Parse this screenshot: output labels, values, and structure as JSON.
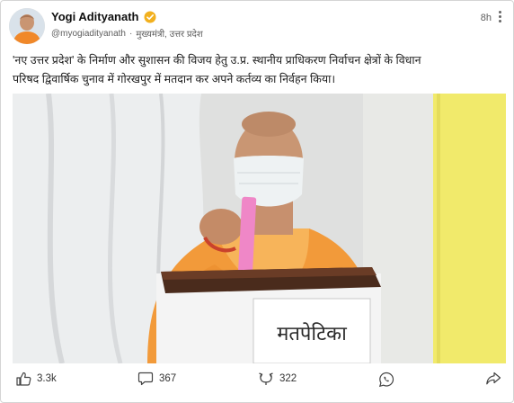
{
  "post": {
    "author_name": "Yogi Adityanath",
    "handle": "@myogiadityanath",
    "separator": "·",
    "designation": "मुख्यमंत्री, उत्तर प्रदेश",
    "time": "8h",
    "text_line1": "'नए उत्तर प्रदेश' के निर्माण और सुशासन की विजय हेतु उ.प्र. स्थानीय प्राधिकरण निर्वाचन क्षेत्रों के विधान",
    "text_line2": "परिषद द्विवार्षिक चुनाव में गोरखपुर में मतदान कर अपने कर्तव्य का निर्वहन किया।",
    "ballot_box_label": "मतपेटिका"
  },
  "actions": {
    "likes": "3.3k",
    "comments": "367",
    "retweets": "322"
  },
  "icons": [
    "verified-badge-icon",
    "more-icon",
    "like-icon",
    "comment-icon",
    "retweet-icon",
    "whatsapp-icon",
    "share-icon"
  ],
  "colors": {
    "verified": "#f2b01e",
    "saffron": "#f29a3a"
  }
}
